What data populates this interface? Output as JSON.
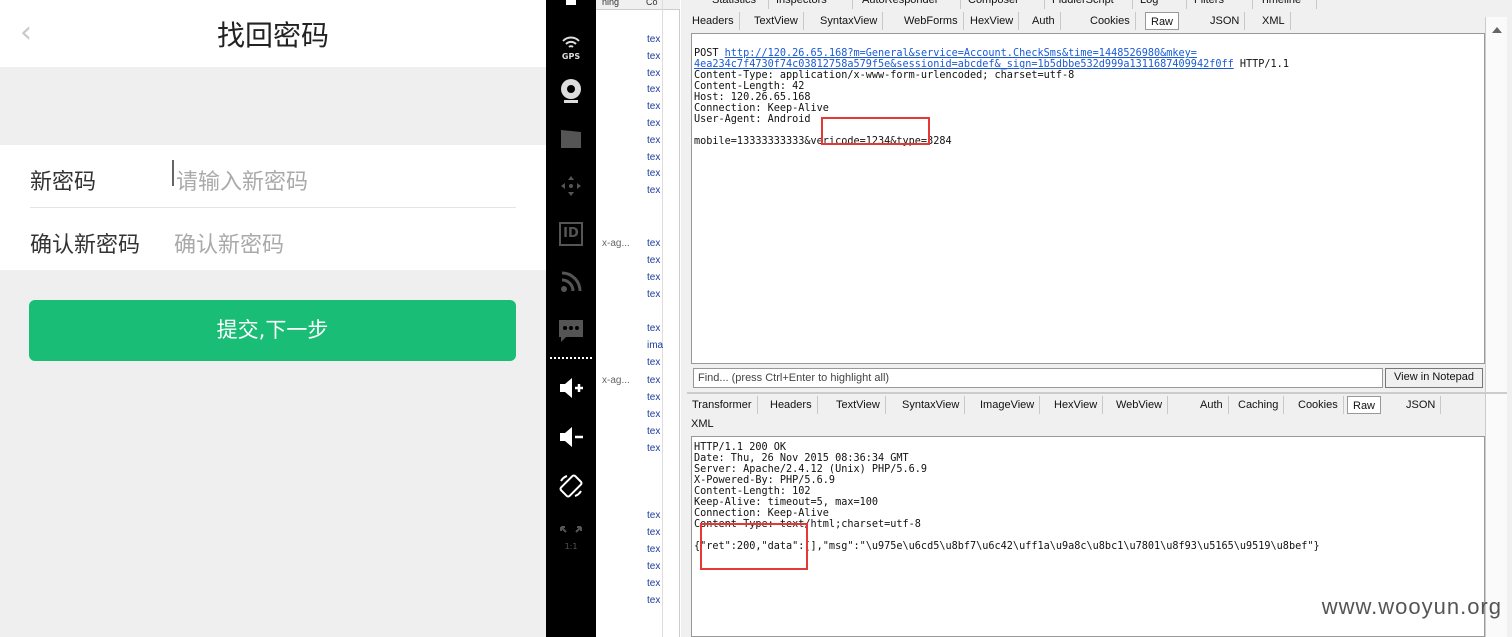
{
  "phone": {
    "title": "找回密码",
    "back_icon": "‹",
    "new_password_label": "新密码",
    "new_password_placeholder": "请输入新密码",
    "confirm_label": "确认新密码",
    "confirm_placeholder": "确认新密码",
    "submit_label": "提交,下一步",
    "accent_color": "#1abd75"
  },
  "emulator_toolbar": {
    "gps_label": "GPS",
    "id_label": "ID",
    "ratio_label": "1:1",
    "icons": [
      "battery-icon",
      "gps-icon",
      "camera-icon",
      "video-icon",
      "dpad-icon",
      "id-icon",
      "rss-icon",
      "sms-icon",
      "volume-up-icon",
      "volume-down-icon",
      "rotate-icon",
      "scale-icon"
    ]
  },
  "sessions": {
    "col1": "ning",
    "col2": "Co",
    "rows": [
      "tex",
      "tex",
      "tex",
      "tex",
      "tex",
      "tex",
      "tex",
      "tex",
      "tex",
      "tex"
    ],
    "rows2_host": "x-ag...",
    "rows2": [
      "tex",
      "tex",
      "tex",
      "tex"
    ],
    "rows3_host": "x-ag...",
    "rows3": [
      "tex",
      "ima",
      "tex",
      "tex",
      "tex",
      "tex",
      "tex",
      "tex"
    ],
    "rows4": [
      "tex",
      "tex",
      "tex",
      "tex",
      "tex",
      "tex"
    ]
  },
  "top_tabs": [
    "Statistics",
    "Inspectors",
    "AutoResponder",
    "Composer",
    "FiddlerScript",
    "Log",
    "Filters",
    "Timeline"
  ],
  "request_tabs": [
    "Headers",
    "TextView",
    "SyntaxView",
    "WebForms",
    "HexView",
    "Auth",
    "Cookies",
    "Raw",
    "JSON",
    "XML"
  ],
  "request": {
    "method": "POST ",
    "url_line1": "http://120.26.65.168?m=General&service=Account.CheckSms&time=1448526980&mkey=",
    "url_line2": "4ea234c7f4730f74c03812758a579f5e&sessionid=abcdef&_sign=1b5dbbe532d999a1311687409942f0ff",
    "protocol": " HTTP/1.1",
    "headers": [
      "Content-Type: application/x-www-form-urlencoded; charset=utf-8",
      "Content-Length: 42",
      "Host: 120.26.65.168",
      "Connection: Keep-Alive",
      "User-Agent: Android"
    ],
    "body": "mobile=13333333333&vericode=1234&type=3284"
  },
  "find_placeholder": "Find... (press Ctrl+Enter to highlight all)",
  "view_in_notepad": "View in Notepad",
  "response_tabs": [
    "Transformer",
    "Headers",
    "TextView",
    "SyntaxView",
    "ImageView",
    "HexView",
    "WebView",
    "Auth",
    "Caching",
    "Cookies",
    "Raw",
    "JSON"
  ],
  "response_tab_xml": "XML",
  "response": {
    "lines": [
      "HTTP/1.1 200 OK",
      "Date: Thu, 26 Nov 2015 08:36:34 GMT",
      "Server: Apache/2.4.12 (Unix) PHP/5.6.9",
      "X-Powered-By: PHP/5.6.9",
      "Content-Length: 102",
      "Keep-Alive: timeout=5, max=100",
      "Connection: Keep-Alive",
      "Content-Type: text/html;charset=utf-8"
    ],
    "body": "{\"ret\":200,\"data\":[],\"msg\":\"\\u975e\\u6cd5\\u8bf7\\u6c42\\uff1a\\u9a8c\\u8bc1\\u7801\\u8f93\\u5165\\u9519\\u8bef\"}"
  },
  "watermark": "www.wooyun.org",
  "highlight_color": "#e53935"
}
